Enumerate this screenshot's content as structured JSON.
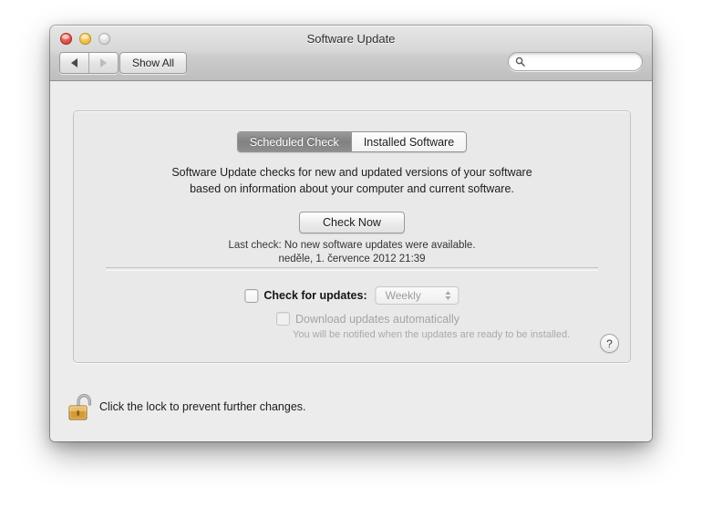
{
  "window": {
    "title": "Software Update",
    "traffic_lights": [
      {
        "name": "close",
        "color": "#d94f45"
      },
      {
        "name": "minimize",
        "color": "#f0bd44"
      },
      {
        "name": "zoom",
        "color": "#dcdcdc"
      }
    ]
  },
  "toolbar": {
    "back_icon": "back-arrow-icon",
    "forward_icon": "forward-arrow-icon",
    "show_all_label": "Show All",
    "search_icon": "search-icon",
    "search_value": "",
    "search_placeholder": ""
  },
  "tabs": [
    {
      "label": "Scheduled Check",
      "active": false
    },
    {
      "label": "Installed Software",
      "active": true
    }
  ],
  "panel": {
    "description_line1": "Software Update checks for new and updated versions of your software",
    "description_line2": "based on information about your computer and current software.",
    "check_now_label": "Check Now",
    "last_check_label": "Last check:",
    "last_check_status": "No new software updates were available.",
    "last_check_date": "neděle, 1. července 2012 21:39",
    "schedule": {
      "checkbox_checked": false,
      "label": "Check for updates:",
      "frequency_value": "Weekly",
      "frequency_enabled": false,
      "stepper_icon": "stepper-arrows-icon"
    },
    "download": {
      "checkbox_checked": false,
      "checkbox_enabled": false,
      "label": "Download updates automatically",
      "note": "You will be notified when the updates are ready to be installed."
    },
    "help_label": "?",
    "help_icon": "help-question-icon"
  },
  "footer": {
    "lock_icon": "unlocked-padlock-icon",
    "lock_text": "Click the lock to prevent further changes."
  }
}
